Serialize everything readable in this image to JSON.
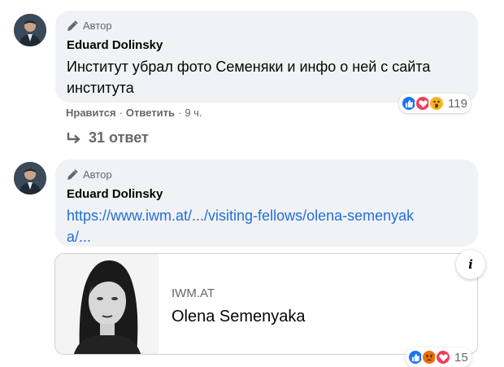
{
  "comments": [
    {
      "badge": "Автор",
      "author": "Eduard Dolinsky",
      "text": "Институт убрал фото Семеняки и инфо о ней с сайта института",
      "actions": {
        "like": "Нравится",
        "reply": "Ответить",
        "time": "9 ч."
      },
      "reactions": {
        "icons": [
          "like-icon",
          "love-icon",
          "wow-icon"
        ],
        "count": "119"
      }
    },
    {
      "badge": "Автор",
      "author": "Eduard Dolinsky",
      "link_text": "https://www.iwm.at/.../visiting-fellows/olena-semenyaka/...",
      "reactions": {
        "icons": [
          "like-icon",
          "angry-icon",
          "love-icon"
        ],
        "count": "15"
      }
    }
  ],
  "replies": {
    "label": "31 ответ"
  },
  "link_card": {
    "domain": "IWM.AT",
    "title": "Olena Semenyaka",
    "info_icon": "i"
  },
  "colors": {
    "bubble": "#f0f2f5",
    "link": "#216fdb",
    "like": "#1877f2",
    "love": "#f33e58",
    "wow": "#f7b125",
    "angry": "#e9710f",
    "muted": "#65676b"
  }
}
